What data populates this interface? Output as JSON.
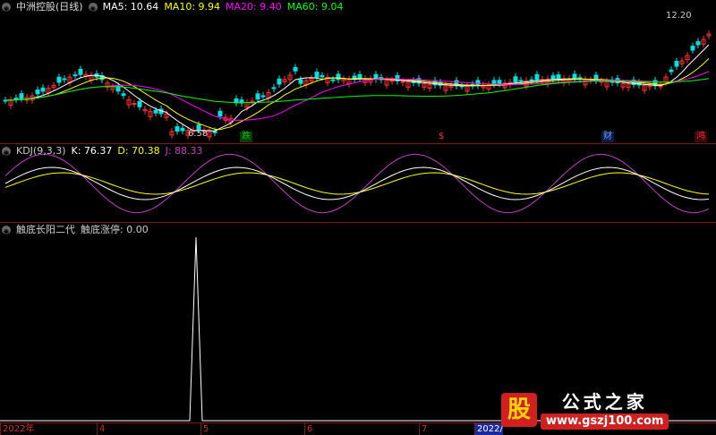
{
  "price_pane": {
    "title": "中洲控股(日线)",
    "ma": [
      {
        "label": "MA5: 10.64",
        "color": "#ffffff"
      },
      {
        "label": "MA10: 9.94",
        "color": "#ffff00"
      },
      {
        "label": "MA20: 9.40",
        "color": "#ff00ff"
      },
      {
        "label": "MA60: 9.04",
        "color": "#00ff00"
      }
    ],
    "high_label": "12.20",
    "low_label": "6.58",
    "events": [
      {
        "text": "跌",
        "color": "#00c000",
        "bg": "#0a3a0a"
      },
      {
        "text": "$",
        "color": "#ff3030",
        "bg": "transparent"
      },
      {
        "text": "财",
        "color": "#66a0ff",
        "bg": "#0a1a4a"
      },
      {
        "text": "鸿",
        "color": "#ff3030",
        "bg": "#3a0a0a"
      }
    ]
  },
  "kdj_pane": {
    "title": "KDJ(9,3,3)",
    "k": {
      "label": "K: 76.37",
      "color": "#ffffff"
    },
    "d": {
      "label": "D: 70.38",
      "color": "#ffff00"
    },
    "j": {
      "label": "J: 88.33",
      "color": "#c040c0"
    }
  },
  "tech_pane": {
    "title": "触底长阳二代",
    "value_label": "触底涨停: 0.00"
  },
  "time_axis": [
    {
      "label": "2022年",
      "hl": false
    },
    {
      "label": "4",
      "hl": false
    },
    {
      "label": "5",
      "hl": false
    },
    {
      "label": "6",
      "hl": false
    },
    {
      "label": "7",
      "hl": false
    },
    {
      "label": "2022/",
      "hl": true
    }
  ],
  "watermark": {
    "badge": "股",
    "title": "公式之家",
    "url": "www.gszj100.com"
  }
}
